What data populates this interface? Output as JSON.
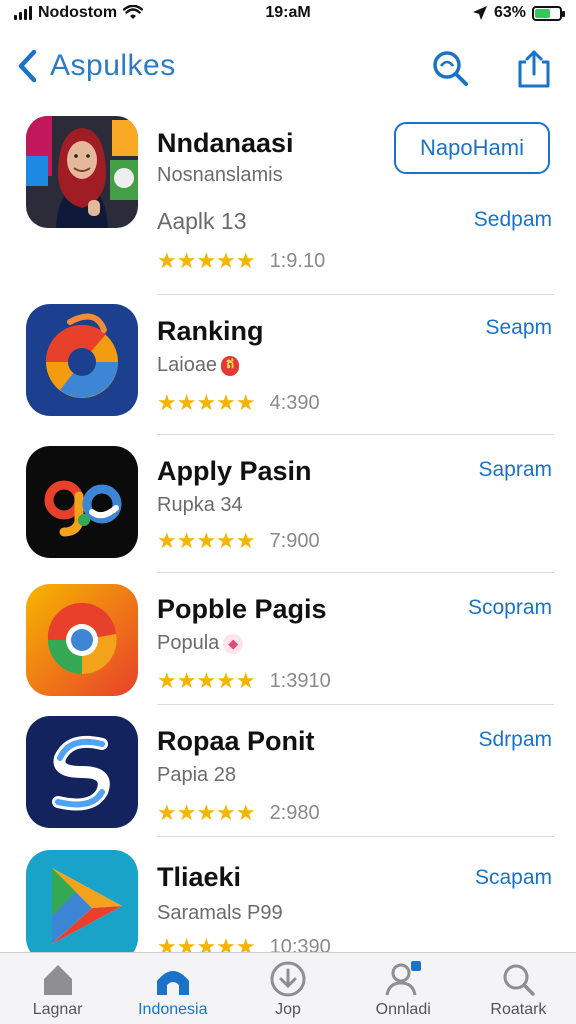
{
  "status_bar": {
    "carrier": "Nodostom",
    "time": "19:aM",
    "battery": "63%",
    "battery_level": 0.63
  },
  "nav": {
    "back_label": "Aspulkes"
  },
  "featured": {
    "name": "Nndanaasi",
    "subtitle": "Nosnanslamis",
    "category": "Aaplk 13",
    "stars": "★★★★★",
    "rating_count": "1:9.10",
    "button": "NapoHami",
    "action": "Sedpam"
  },
  "apps": [
    {
      "name": "Ranking",
      "subtitle": "Laioae",
      "badge": "ឥ",
      "badge_color": "#e53935",
      "stars": "★★★★★",
      "rating_count": "4:390",
      "action": "Seapm"
    },
    {
      "name": "Apply Pasin",
      "subtitle": "Rupka 34",
      "badge": "",
      "stars": "★★★★★",
      "rating_count": "7:900",
      "action": "Sapram"
    },
    {
      "name": "Popble Pagis",
      "subtitle": "Popula",
      "badge": "◆",
      "badge_color": "#e04a7b",
      "stars": "★★★★★",
      "rating_count": "1:3910",
      "action": "Scopram"
    },
    {
      "name": "Ropaa Ponit",
      "subtitle": "Papia 28",
      "badge": "",
      "stars": "★★★★★",
      "rating_count": "2:980",
      "action": "Sdrpam"
    },
    {
      "name": "Tliaeki",
      "subtitle": "Saramals P99",
      "badge": "",
      "stars": "★★★★★",
      "rating_count": "10:390",
      "action": "Scapam"
    }
  ],
  "tabs": [
    {
      "label": "Lagnar",
      "icon": "home-icon"
    },
    {
      "label": "Indonesia",
      "icon": "home-filled-icon"
    },
    {
      "label": "Jop",
      "icon": "download-icon"
    },
    {
      "label": "Onnladi",
      "icon": "person-icon"
    },
    {
      "label": "Roatark",
      "icon": "search-icon"
    }
  ],
  "colors": {
    "accent": "#1a73c9",
    "star": "#f5b400"
  }
}
